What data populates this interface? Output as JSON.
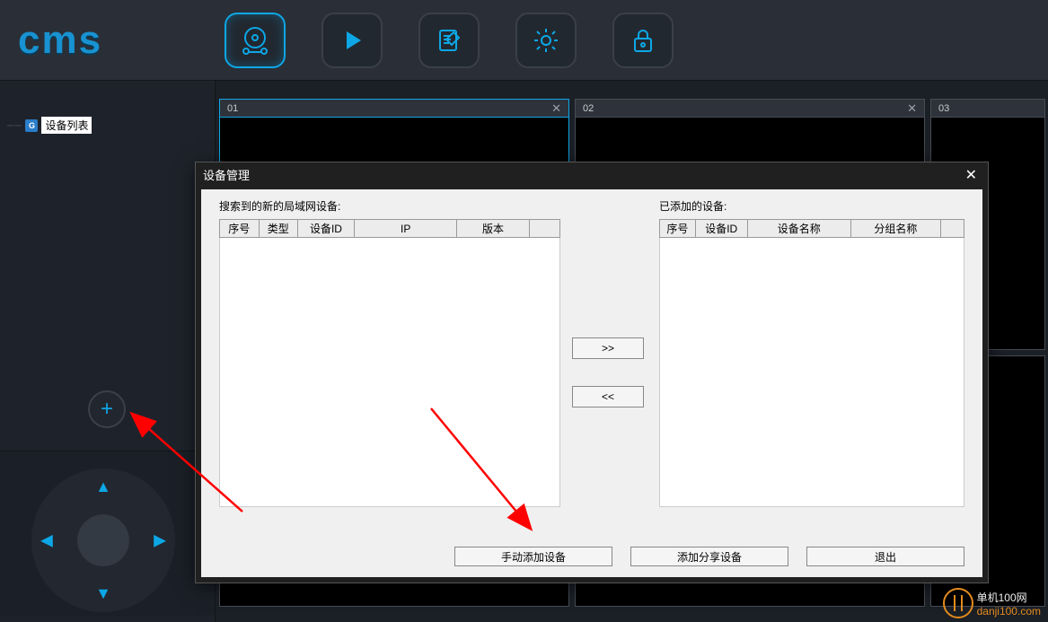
{
  "app": {
    "logo_text": "cms"
  },
  "nav_icons": [
    "preview-icon",
    "play-icon",
    "log-icon",
    "gear-icon",
    "lock-icon"
  ],
  "sidebar": {
    "tree_root": "设备列表",
    "tree_ico_letter": "G",
    "add_glyph": "+"
  },
  "panes": [
    {
      "label": "01"
    },
    {
      "label": "02"
    },
    {
      "label": "03"
    }
  ],
  "modal": {
    "title": "设备管理",
    "left_caption": "搜索到的新的局域网设备:",
    "right_caption": "已添加的设备:",
    "left_cols": [
      "序号",
      "类型",
      "设备ID",
      "IP",
      "版本"
    ],
    "right_cols": [
      "序号",
      "设备ID",
      "设备名称",
      "分组名称"
    ],
    "to_right": ">>",
    "to_left": "<<",
    "btn_manual": "手动添加设备",
    "btn_share": "添加分享设备",
    "btn_exit": "退出"
  },
  "watermark": {
    "line1": "单机100网",
    "line2": "danji100.com"
  }
}
